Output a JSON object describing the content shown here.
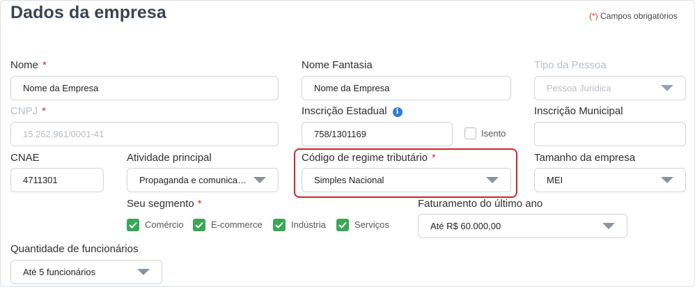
{
  "header": {
    "title": "Dados da empresa",
    "required_mark": "(*)",
    "required_note": "Campos obrigatórios"
  },
  "fields": {
    "nome": {
      "label": "Nome",
      "value": "Nome da Empresa",
      "required": "*"
    },
    "nome_fantasia": {
      "label": "Nome Fantasia",
      "value": "Nome da Empresa"
    },
    "tipo_pessoa": {
      "label": "Tipo da Pessoa",
      "value": "Pessoa Jurídica"
    },
    "cnpj": {
      "label": "CNPJ",
      "placeholder": "15.262.961/0001-41",
      "required": "*"
    },
    "inscricao_estadual": {
      "label": "Inscrição Estadual",
      "value": "758/1301169",
      "isento_label": "Isento"
    },
    "inscricao_municipal": {
      "label": "Inscrição Municipal",
      "value": ""
    },
    "cnae": {
      "label": "CNAE",
      "value": "4711301"
    },
    "atividade_principal": {
      "label": "Atividade principal",
      "value": "Propaganda e comunicação"
    },
    "regime_tributario": {
      "label": "Código de regime tributário",
      "value": "Simples Nacional",
      "required": "*"
    },
    "tamanho_empresa": {
      "label": "Tamanho da empresa",
      "value": "MEI"
    },
    "segmento": {
      "label": "Seu segmento",
      "required": "*",
      "options": [
        "Comércio",
        "E-commerce",
        "Indústria",
        "Serviços"
      ]
    },
    "faturamento": {
      "label": "Faturamento do último ano",
      "value": "Até R$ 60.000,00"
    },
    "funcionarios": {
      "label": "Quantidade de funcionários",
      "value": "Até 5 funcionários"
    }
  },
  "colors": {
    "accent_red": "#c9242d",
    "check_green": "#3aa757",
    "info_blue": "#2d7fd3"
  }
}
